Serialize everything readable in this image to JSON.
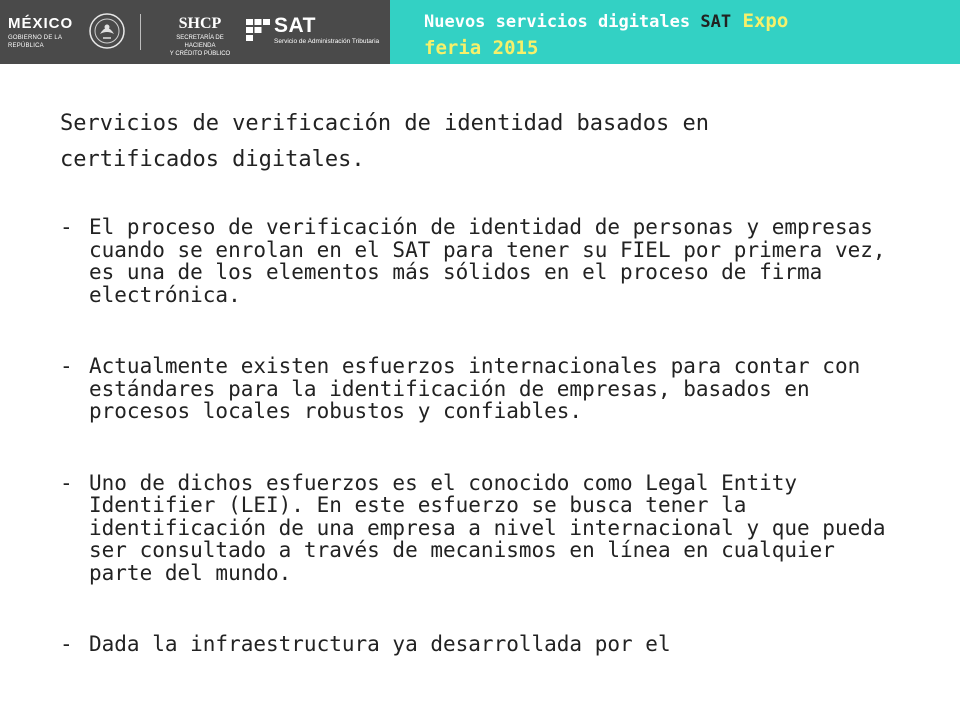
{
  "header": {
    "logos": {
      "mexico_title": "MÉXICO",
      "mexico_subtitle": "GOBIERNO DE LA REPÚBLICA",
      "shcp_title": "SHCP",
      "shcp_line1": "SECRETARÍA DE HACIENDA",
      "shcp_line2": "Y CRÉDITO PÚBLICO",
      "sat_title": "SAT",
      "sat_subtitle": "Servicio de Administración Tributaria"
    },
    "title_part1": "Nuevos servicios digitales ",
    "title_part2": "SAT",
    "title_part3": " Expo",
    "title_part4": "feria 2015",
    "colors": {
      "logo_bar": "#4a4a4a",
      "title_bar": "#33d1c4",
      "title_highlight": "#f6f06a"
    }
  },
  "content": {
    "intro": "Servicios de verificación de identidad basados en certificados digitales.",
    "bullet_marker": "-",
    "bullets": [
      "El proceso de verificación de identidad de personas y empresas cuando se enrolan en el SAT para tener su FIEL por primera vez, es una de los elementos más sólidos en el proceso de firma electrónica.",
      "Actualmente existen esfuerzos internacionales para contar con estándares para la identificación de empresas, basados en procesos locales robustos y confiables.",
      "Uno de dichos esfuerzos es el conocido como Legal Entity Identifier (LEI). En este esfuerzo se busca tener la identificación de una empresa a nivel internacional y que pueda ser consultado a través de mecanismos en línea en cualquier parte del mundo.",
      "Dada la infraestructura ya desarrollada por el"
    ]
  }
}
